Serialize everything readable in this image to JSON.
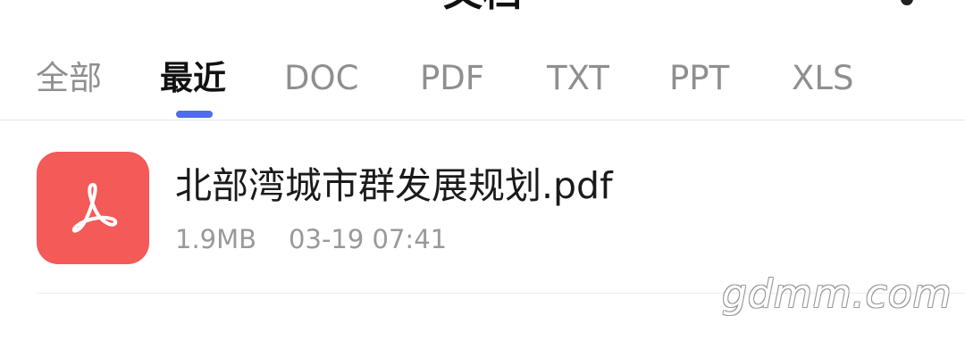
{
  "header": {
    "title": "文档"
  },
  "tabs": [
    {
      "label": "全部"
    },
    {
      "label": "最近"
    },
    {
      "label": "DOC"
    },
    {
      "label": "PDF"
    },
    {
      "label": "TXT"
    },
    {
      "label": "PPT"
    },
    {
      "label": "XLS"
    }
  ],
  "active_tab": "最近",
  "files": [
    {
      "name": "北部湾城市群发展规划.pdf",
      "size": "1.9MB",
      "date": "03-19 07:41",
      "icon": "pdf-icon"
    }
  ],
  "watermark": "gdmm.com",
  "colors": {
    "accent": "#4f6de8",
    "pdf_icon_bg": "#f45a57",
    "muted_text": "#8f8f8f"
  }
}
